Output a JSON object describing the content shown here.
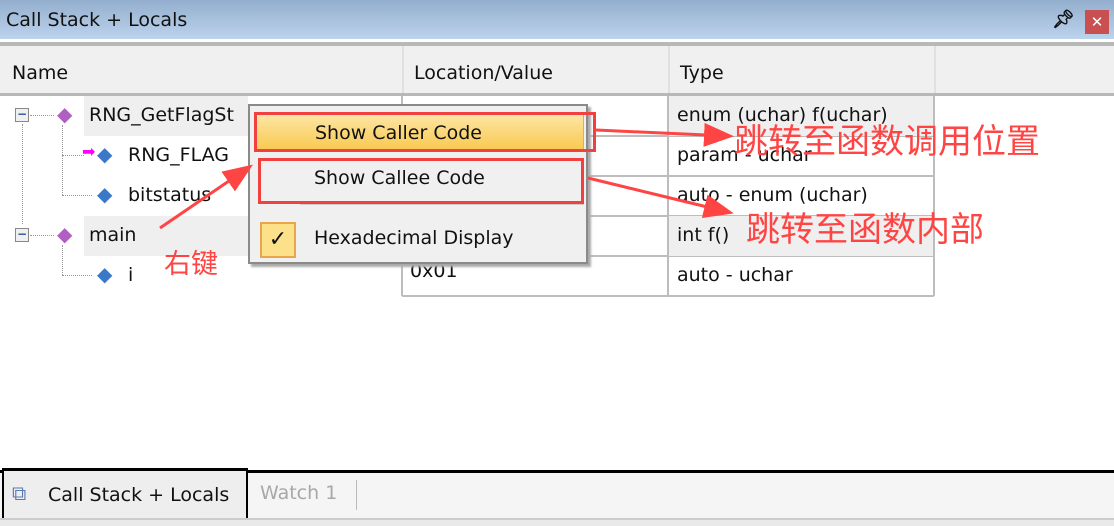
{
  "window": {
    "title": "Call Stack + Locals",
    "pin_icon": "pin-icon",
    "close_icon": "close-icon"
  },
  "columns": [
    "Name",
    "Location/Value",
    "Type"
  ],
  "rows": [
    {
      "name": "RNG_GetFlagSt",
      "value": "",
      "type": "enum (uchar) f(uchar)",
      "icon": "function-icon"
    },
    {
      "name": "RNG_FLAG",
      "value": "",
      "type": "param - uchar",
      "icon": "parameter-icon"
    },
    {
      "name": "bitstatus",
      "value": "",
      "type": "auto - enum (uchar)",
      "icon": "variable-icon"
    },
    {
      "name": "main",
      "value": "",
      "type": "int f()",
      "icon": "function-icon"
    },
    {
      "name": "i",
      "value": "0x01",
      "type": "auto - uchar",
      "icon": "variable-icon"
    }
  ],
  "context_menu": {
    "items": [
      "Show Caller Code",
      "Show Callee Code",
      "Hexadecimal Display"
    ],
    "hex_checked": true
  },
  "annotations": {
    "right_click": "右键",
    "caller": "跳转至函数调用位置",
    "callee": "跳转至函数内部",
    "color": "#f44444"
  },
  "tabs": [
    "Call Stack + Locals",
    "Watch 1"
  ]
}
